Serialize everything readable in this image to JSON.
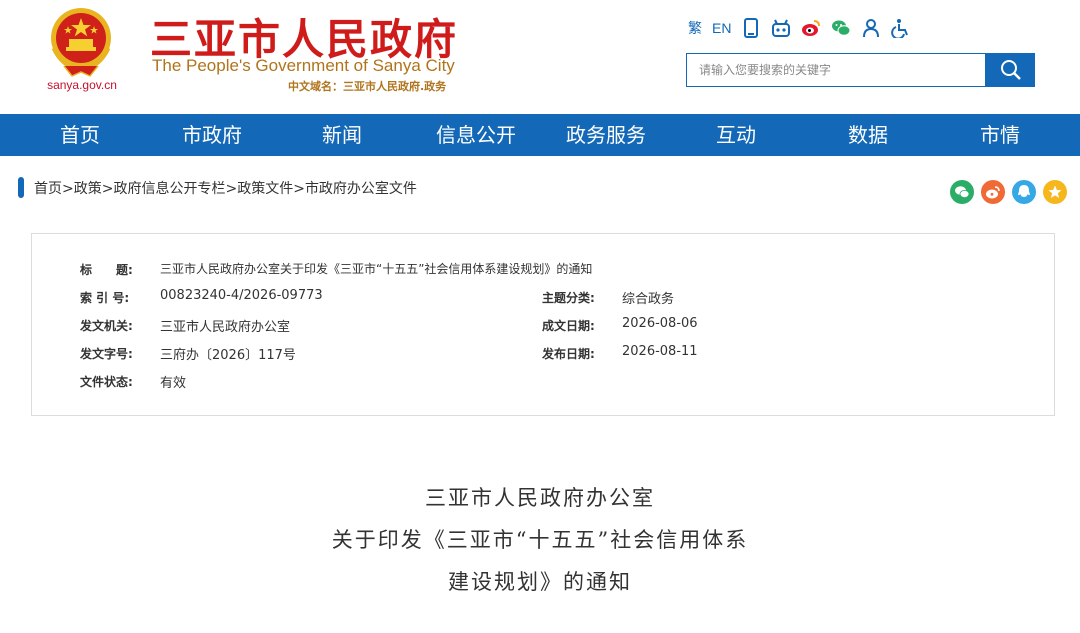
{
  "header": {
    "site_title": "三亚市人民政府",
    "site_subtitle": "The People's Government of Sanya City",
    "cn_domain": "中文域名：三亚市人民政府.政务",
    "domain": "sanya.gov.cn",
    "lang_traditional": "繁",
    "lang_english": "EN",
    "search_placeholder": "请输入您要搜索的关键字",
    "colors": {
      "brand_red": "#d01b1b",
      "brand_blue": "#1368b7",
      "gold": "#b0741c"
    },
    "tools": [
      "mobile-icon",
      "robot-icon",
      "weibo-icon",
      "wechat-icon",
      "user-icon",
      "accessibility-icon"
    ]
  },
  "nav": {
    "items": [
      "首页",
      "市政府",
      "新闻",
      "信息公开",
      "政务服务",
      "互动",
      "数据",
      "市情"
    ]
  },
  "breadcrumb": {
    "items": [
      "首页",
      "政策",
      "政府信息公开专栏",
      "政策文件",
      "市政府办公室文件"
    ],
    "separator": ">"
  },
  "share_icons": [
    "wechat-share-icon",
    "weibo-share-icon",
    "qq-share-icon",
    "favorite-icon"
  ],
  "info": {
    "title_label": "标　　题:",
    "title_value": "三亚市人民政府办公室关于印发《三亚市“十五五”社会信用体系建设规划》的通知",
    "index_label": "索 引 号:",
    "index_value": "00823240-4/2026-09773",
    "topic_label": "主题分类:",
    "topic_value": "综合政务",
    "issuer_label": "发文机关:",
    "issuer_value": "三亚市人民政府办公室",
    "created_label": "成文日期:",
    "created_value": "2026-08-06",
    "docno_label": "发文字号:",
    "docno_value": "三府办〔2026〕117号",
    "published_label": "发布日期:",
    "published_value": "2026-08-11",
    "status_label": "文件状态:",
    "status_value": "有效"
  },
  "document": {
    "title_line1": "三亚市人民政府办公室",
    "title_line2": "关于印发《三亚市“十五五”社会信用体系",
    "title_line3": "建设规划》的通知"
  }
}
